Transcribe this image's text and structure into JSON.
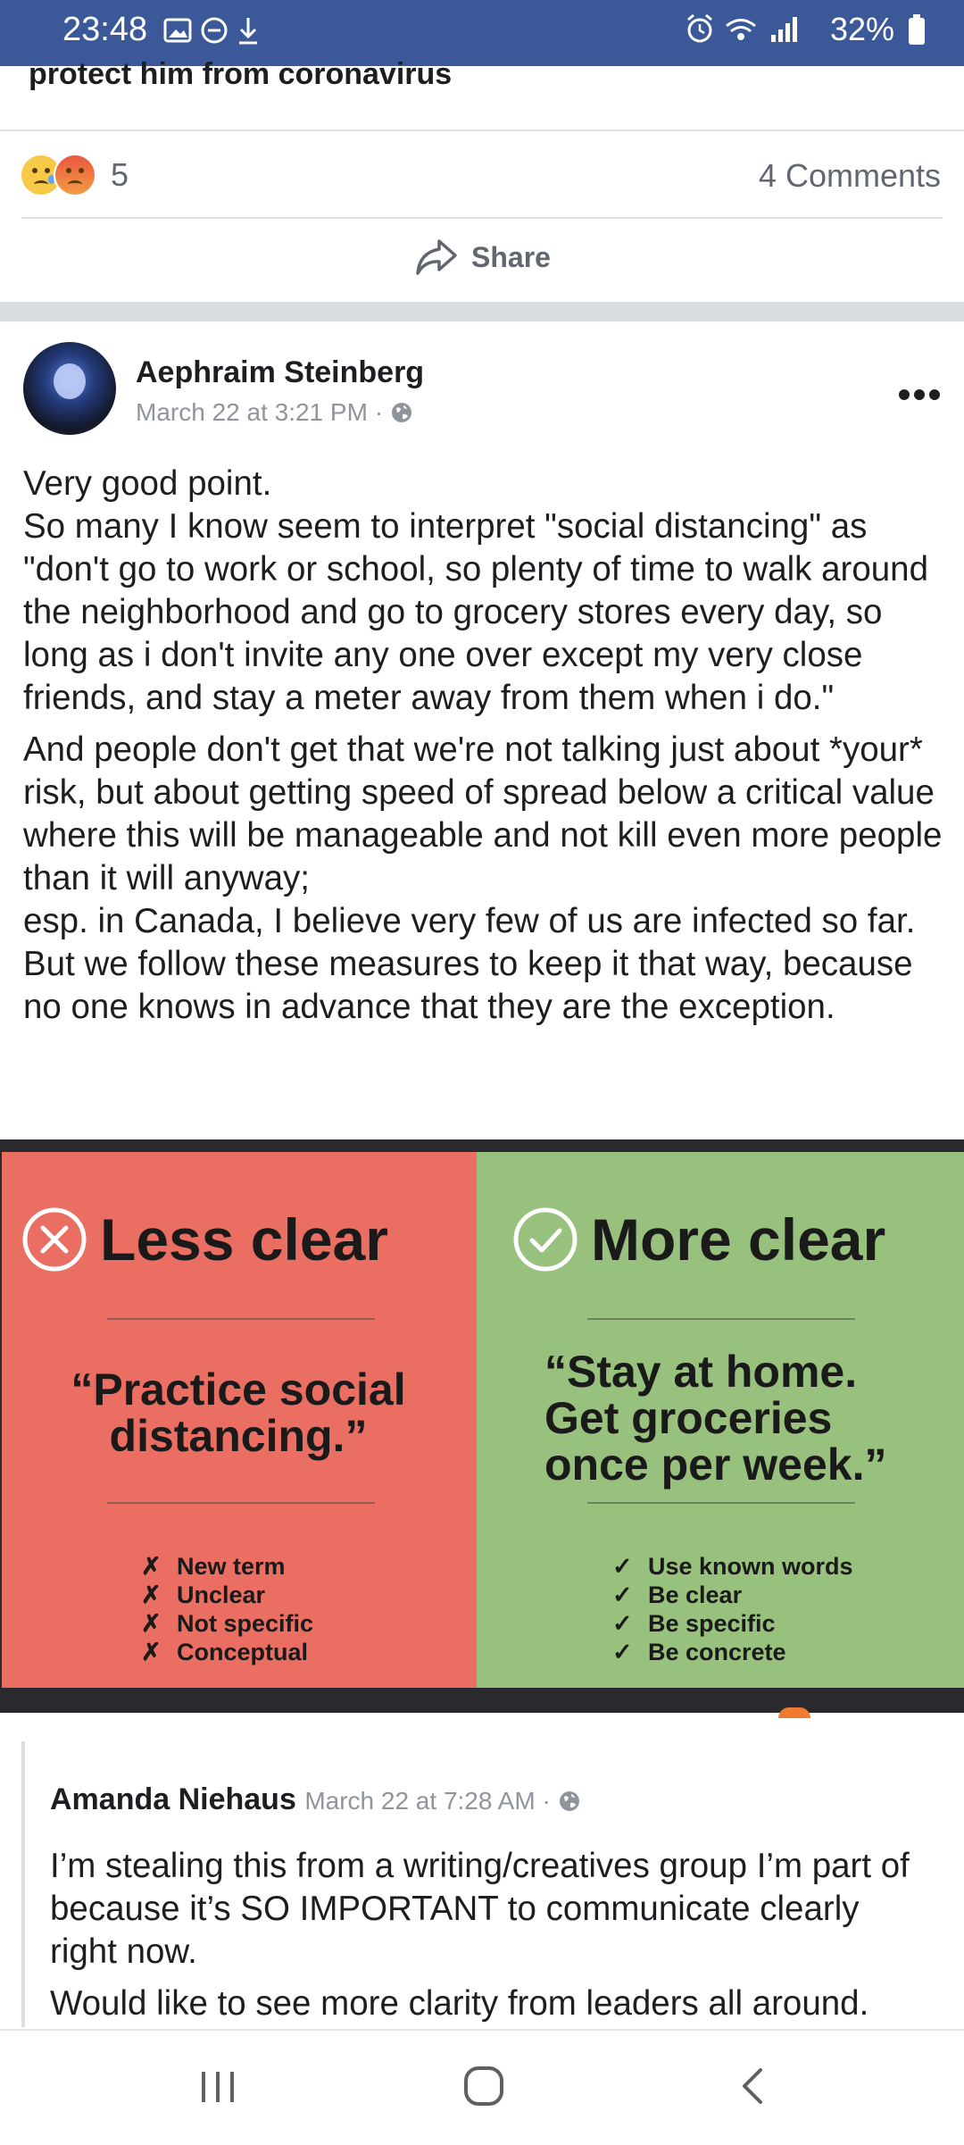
{
  "status_bar": {
    "time": "23:48",
    "battery": "32%"
  },
  "previous_post": {
    "title_tail": "protect him from coronavirus",
    "reaction_count": "5",
    "comments_label": "4 Comments",
    "share_label": "Share"
  },
  "post": {
    "author": "Aephraim Steinberg",
    "timestamp": "March 22 at 3:21 PM",
    "separator": "·",
    "paragraph1": "Very good point.\nSo many I know seem to interpret \"social distancing\" as \"don't go to work or school, so plenty of time to walk around the neighborhood and go to grocery stores every day, so long as i don't invite any one over except my very close friends, and stay a meter away from them when i do.\"",
    "paragraph2": "And people don't get that we're not talking just about *your* risk, but about getting speed of spread below a critical value where this will be manageable and not kill even more people than it will anyway;\nesp. in Canada, I believe very few of us are infected so far. But we follow these measures to keep it that way, because no one knows in advance that they are the exception."
  },
  "infographic": {
    "left": {
      "heading": "Less clear",
      "quote": "“Practice social distancing.”",
      "bullets": [
        "New term",
        "Unclear",
        "Not specific",
        "Conceptual"
      ],
      "bullet_mark": "✗",
      "color": "#ea6e62"
    },
    "right": {
      "heading": "More clear",
      "quote": "“Stay at home. Get groceries once per week.”",
      "bullets": [
        "Use known words",
        "Be clear",
        "Be specific",
        "Be concrete"
      ],
      "bullet_mark": "✓",
      "color": "#97c17c"
    }
  },
  "comment": {
    "author": "Amanda Niehaus",
    "timestamp": "March 22 at 7:28 AM",
    "separator": "·",
    "paragraph1": "I’m stealing this from a writing/creatives group I’m part of because it’s SO IMPORTANT to communicate clearly right now.",
    "paragraph2": "Would like to see more clarity from leaders all around."
  },
  "colors": {
    "status_bar": "#3b5998",
    "meta_text": "#90949c",
    "divider": "#dadde1"
  },
  "icons": [
    "image-icon",
    "do-not-disturb-icon",
    "download-icon",
    "alarm-icon",
    "wifi-icon",
    "signal-icon",
    "battery-icon",
    "share-icon",
    "globe-icon",
    "more-icon",
    "x-circle-icon",
    "check-circle-icon",
    "recents-icon",
    "home-icon",
    "back-icon"
  ]
}
